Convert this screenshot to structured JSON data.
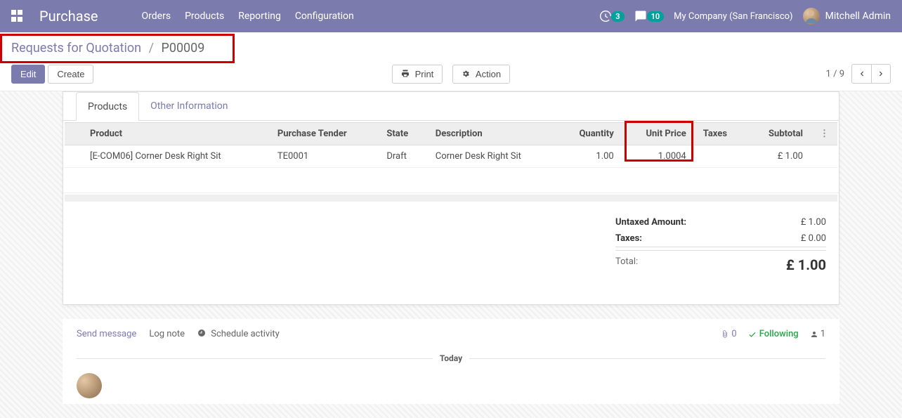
{
  "topbar": {
    "app_title": "Purchase",
    "menu": [
      "Orders",
      "Products",
      "Reporting",
      "Configuration"
    ],
    "activities_count": "3",
    "discuss_count": "10",
    "company": "My Company (San Francisco)",
    "user": "Mitchell Admin"
  },
  "breadcrumb": {
    "parent": "Requests for Quotation",
    "current": "P00009"
  },
  "toolbar": {
    "edit": "Edit",
    "create": "Create",
    "print": "Print",
    "action": "Action"
  },
  "pager": {
    "position": "1",
    "total": "9"
  },
  "tabs": {
    "products": "Products",
    "other": "Other Information"
  },
  "lines": {
    "headers": {
      "product": "Product",
      "tender": "Purchase Tender",
      "state": "State",
      "description": "Description",
      "quantity": "Quantity",
      "unit_price": "Unit Price",
      "taxes": "Taxes",
      "subtotal": "Subtotal"
    },
    "rows": [
      {
        "product": "[E-COM06] Corner Desk Right Sit",
        "tender": "TE0001",
        "state": "Draft",
        "description": "Corner Desk Right Sit",
        "quantity": "1.00",
        "unit_price": "1.0004",
        "taxes": "",
        "subtotal": "£ 1.00"
      }
    ]
  },
  "totals": {
    "untaxed_label": "Untaxed Amount:",
    "untaxed_value": "£ 1.00",
    "taxes_label": "Taxes:",
    "taxes_value": "£ 0.00",
    "total_label": "Total:",
    "total_value": "£ 1.00"
  },
  "chatter": {
    "send": "Send message",
    "log": "Log note",
    "schedule": "Schedule activity",
    "attach_count": "0",
    "following": "Following",
    "followers_count": "1",
    "today": "Today"
  }
}
